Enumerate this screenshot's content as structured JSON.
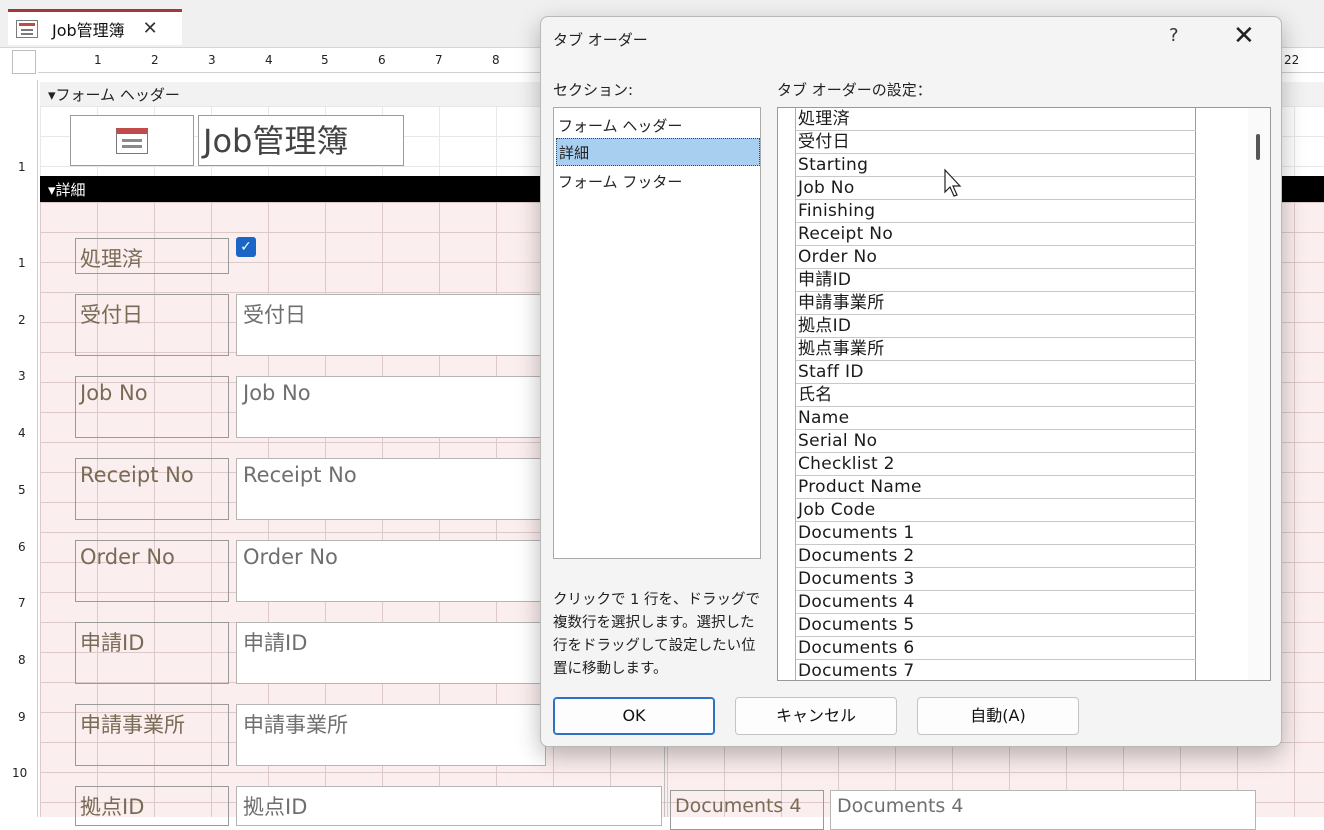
{
  "tab": {
    "title": "Job管理簿",
    "close": "✕"
  },
  "ruler": {
    "top": [
      "1",
      "2",
      "3",
      "4",
      "5",
      "6",
      "7",
      "8",
      "22"
    ],
    "left": [
      "1",
      "1",
      "2",
      "3",
      "4",
      "5",
      "6",
      "7",
      "8",
      "9",
      "10"
    ]
  },
  "form": {
    "header_bar": "フォーム ヘッダー",
    "detail_bar": "詳細",
    "title": "Job管理簿",
    "checkbox_mark": "✓",
    "labels": [
      "処理済",
      "受付日",
      "Job No",
      "Receipt No",
      "Order No",
      "申請ID",
      "申請事業所",
      "拠点ID"
    ],
    "fields": [
      "受付日",
      "Job No",
      "Receipt No",
      "Order No",
      "申請ID",
      "申請事業所",
      "拠点ID"
    ],
    "bottom_fields": [
      "Documents 4",
      "Documents 4"
    ]
  },
  "dialog": {
    "title": "タブ オーダー",
    "help": "?",
    "close": "✕",
    "section_label": "セクション:",
    "order_label": "タブ オーダーの設定：",
    "sections": [
      "フォーム ヘッダー",
      "詳細",
      "フォーム フッター"
    ],
    "selected_section": "詳細",
    "hint": "クリックで 1 行を、ドラッグで複数行を選択します。選択した行をドラッグして設定したい位置に移動します。",
    "order_items": [
      "処理済",
      "受付日",
      "Starting",
      "Job No",
      "Finishing",
      "Receipt No",
      "Order No",
      "申請ID",
      "申請事業所",
      "拠点ID",
      "拠点事業所",
      "Staff ID",
      "氏名",
      "Name",
      "Serial No",
      "Checklist 2",
      "Product Name",
      "Job Code",
      "Documents 1",
      "Documents 2",
      "Documents 3",
      "Documents 4",
      "Documents 5",
      "Documents 6",
      "Documents 7"
    ],
    "buttons": {
      "ok": "OK",
      "cancel": "キャンセル",
      "auto": "自動(A)"
    }
  }
}
